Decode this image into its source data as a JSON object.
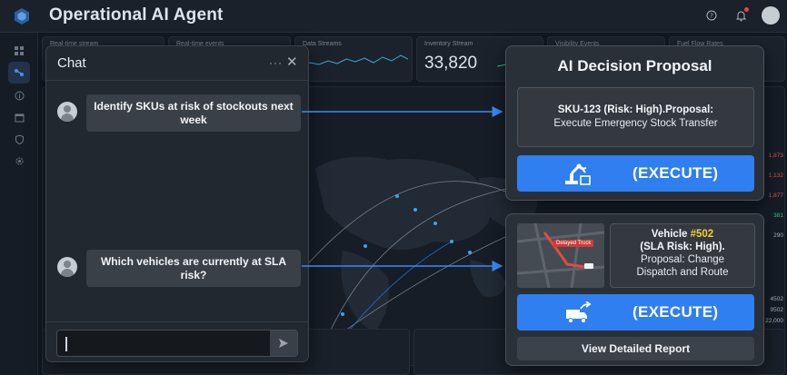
{
  "app": {
    "title": "Operational AI Agent"
  },
  "kpis": [
    {
      "label": "Real-time stream",
      "value": ""
    },
    {
      "label": "Real-time events",
      "value": ""
    },
    {
      "label": "Data Streams",
      "value": ""
    },
    {
      "label": "Inventory Stream",
      "value": "33,820"
    },
    {
      "label": "Visibility Events",
      "value": ""
    },
    {
      "label": "Fuel Flow Rates",
      "value": ""
    }
  ],
  "chat": {
    "title": "Chat",
    "more_label": "···",
    "close_label": "✕",
    "messages": [
      {
        "text": "Identify SKUs at risk of stockouts next week"
      },
      {
        "text": "Which vehicles are currently at SLA risk?"
      }
    ],
    "input": {
      "value": "",
      "placeholder": ""
    }
  },
  "decision": {
    "title": "AI Decision Proposal",
    "sku_proposal_line1": "SKU-123 (Risk: High).Proposal:",
    "sku_proposal_line2": "Execute Emergency Stock Transfer",
    "execute_label": "(EXECUTE)"
  },
  "vehicle": {
    "prefix": "Vehicle ",
    "number": "#502",
    "line2": "(SLA Risk: High).",
    "line3": "Proposal: Change",
    "line4": "Dispatch and Route",
    "map_tag": "Delayed Truck",
    "execute_label": "(EXECUTE)",
    "report_label": "View Detailed Report"
  },
  "colors": {
    "accent": "#2f7ff0",
    "highlight": "#f3d034",
    "danger": "#cf3b34",
    "background": "#121821"
  }
}
